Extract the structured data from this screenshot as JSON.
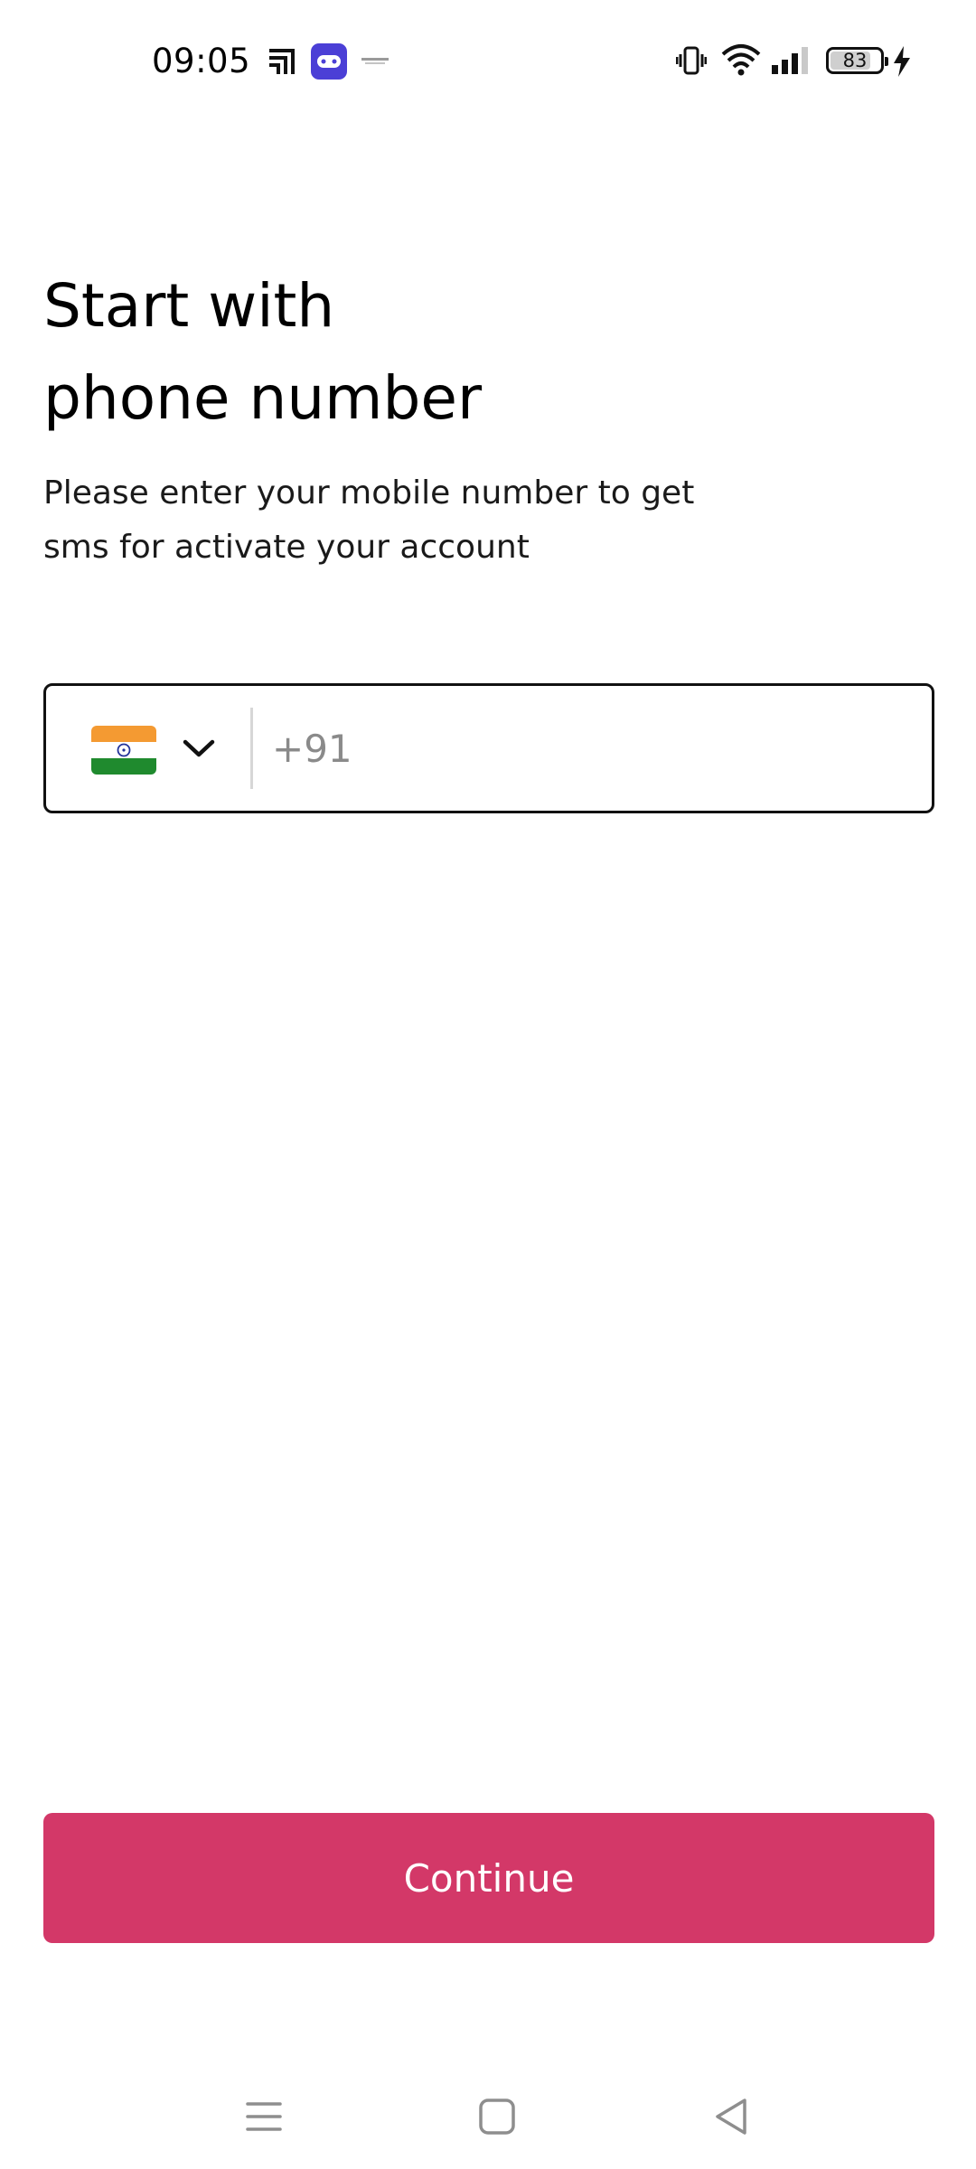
{
  "status_bar": {
    "time": "09:05",
    "battery_level": "83",
    "battery_fraction": 0.83,
    "icons": [
      "cast-icon",
      "game-icon",
      "notification-thumbnail-icon",
      "vibrate-icon",
      "wifi-icon",
      "signal-icon",
      "battery-icon",
      "charging-bolt-icon"
    ]
  },
  "header": {
    "title_line1": "Start with",
    "title_line2": "phone number",
    "subtitle_line1": "Please enter your mobile number to get",
    "subtitle_line2": "sms for activate your account"
  },
  "phone_field": {
    "country_flag": "india-flag",
    "country_dropdown_icon": "chevron-down-icon",
    "placeholder": "+91",
    "value": ""
  },
  "actions": {
    "continue_label": "Continue"
  },
  "colors": {
    "accent": "#d33868",
    "text": "#000000",
    "border": "#111111",
    "divider": "#d7d7d7"
  },
  "nav_bar": {
    "icons": [
      "menu-icon",
      "home-icon",
      "back-icon"
    ]
  }
}
